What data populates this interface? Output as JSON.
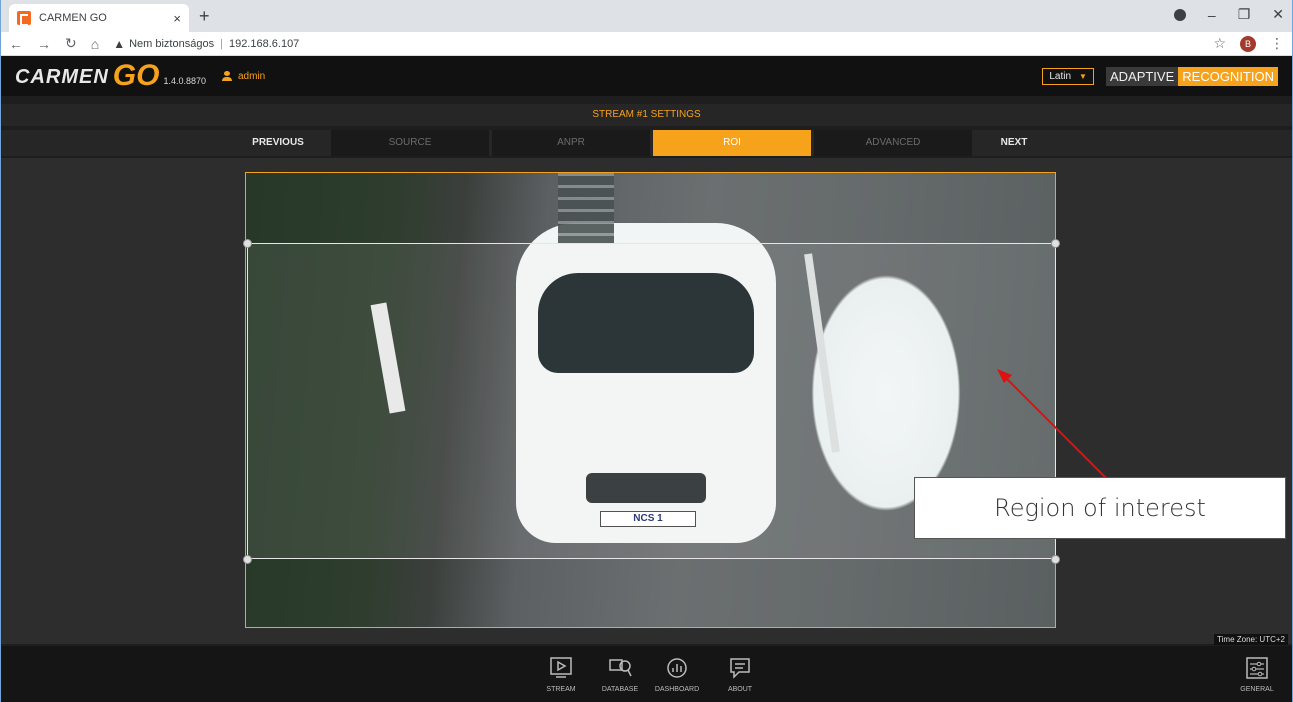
{
  "browser": {
    "tab_title": "CARMEN GO",
    "tab_close": "×",
    "new_tab": "+",
    "security_label": "Nem biztonságos",
    "url": "192.168.6.107",
    "profile_initial": "B"
  },
  "app": {
    "brand": "CARMEN",
    "brand_go": "GO",
    "version": "1.4.0.8870",
    "user": "admin",
    "language": "Latin",
    "vendor_a": "ADAPTIVE",
    "vendor_b": "RECOGNITION",
    "accent": "#f7a21b"
  },
  "stream": {
    "title": "STREAM #1 SETTINGS",
    "previous": "PREVIOUS",
    "next": "NEXT",
    "tabs": [
      "SOURCE",
      "ANPR",
      "ROI",
      "ADVANCED"
    ],
    "active_tab": "ROI"
  },
  "video": {
    "plate": "NCS 1",
    "callout": "Region of interest"
  },
  "timezone": "Time Zone: UTC+2",
  "footer": {
    "items": [
      "STREAM",
      "DATABASE",
      "DASHBOARD",
      "ABOUT"
    ],
    "general": "GENERAL"
  }
}
